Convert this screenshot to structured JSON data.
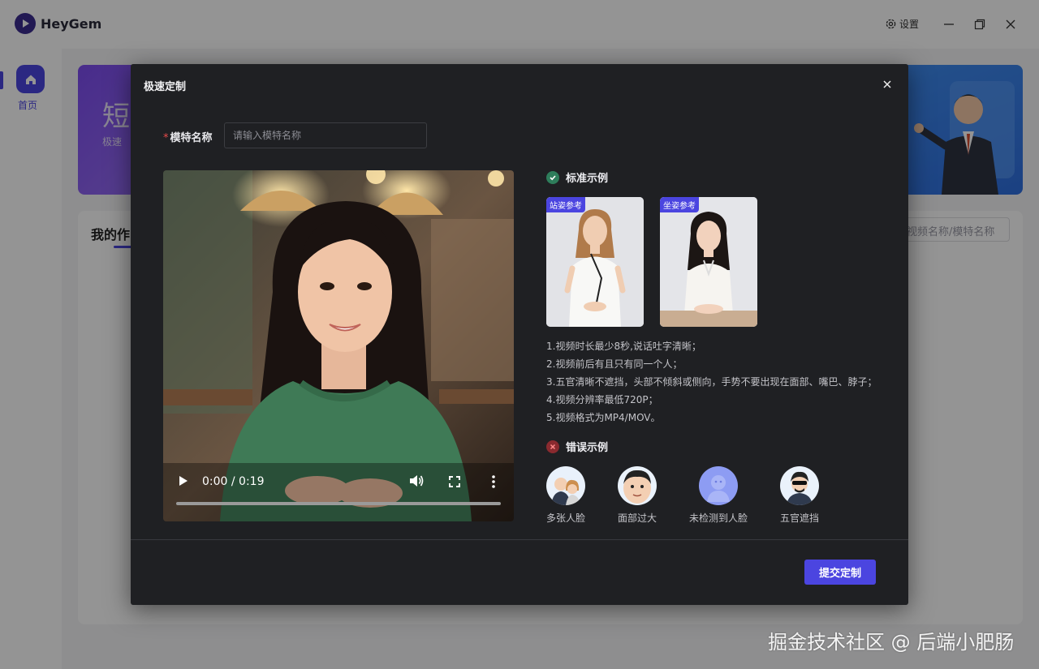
{
  "app": {
    "name": "HeyGem",
    "settings_label": "设置"
  },
  "sidebar": {
    "home_label": "首页"
  },
  "background": {
    "banner_title": "短",
    "banner_sub": "极速",
    "works_title": "我的作",
    "search_placeholder": "视频名称/模特名称"
  },
  "modal": {
    "title": "极速定制",
    "name_label": "模特名称",
    "name_placeholder": "请输入模特名称",
    "video": {
      "time": "0:00 / 0:19",
      "progress": 0.0
    },
    "good_section": {
      "title": "标准示例",
      "cards": [
        {
          "tag": "站姿参考"
        },
        {
          "tag": "坐姿参考"
        }
      ]
    },
    "rules": [
      "1.视频时长最少8秒,说话吐字清晰；",
      "2.视频前后有且只有同一个人；",
      "3.五官清晰不遮挡，头部不倾斜或侧向，手势不要出现在面部、嘴巴、脖子；",
      "4.视频分辨率最低720P；",
      "5.视频格式为MP4/MOV。"
    ],
    "bad_section": {
      "title": "错误示例",
      "items": [
        {
          "label": "多张人脸"
        },
        {
          "label": "面部过大"
        },
        {
          "label": "未检测到人脸"
        },
        {
          "label": "五官遮挡"
        }
      ]
    },
    "submit_label": "提交定制"
  },
  "watermark": "掘金技术社区 @ 后端小肥肠",
  "colors": {
    "accent": "#4b45e0",
    "modal_bg": "#1f2023",
    "ok": "#2e7d5b",
    "error": "#8a2a2f"
  }
}
